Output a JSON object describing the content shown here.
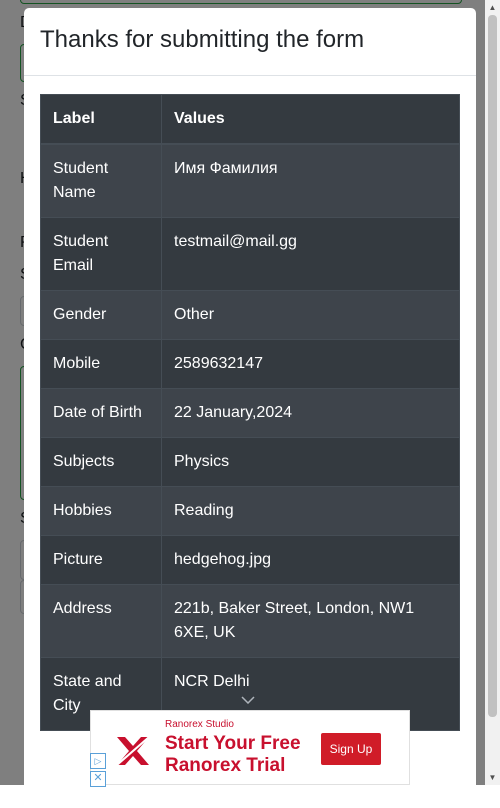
{
  "modal": {
    "title": "Thanks for submitting the form"
  },
  "table": {
    "headers": {
      "label": "Label",
      "values": "Values"
    },
    "rows": [
      {
        "label": "Student Name",
        "value": "Имя Фамилия"
      },
      {
        "label": "Student Email",
        "value": "testmail@mail.gg"
      },
      {
        "label": "Gender",
        "value": "Other"
      },
      {
        "label": "Mobile",
        "value": "2589632147"
      },
      {
        "label": "Date of Birth",
        "value": "22 January,2024"
      },
      {
        "label": "Subjects",
        "value": "Physics"
      },
      {
        "label": "Hobbies",
        "value": "Reading"
      },
      {
        "label": "Picture",
        "value": "hedgehog.jpg"
      },
      {
        "label": "Address",
        "value": "221b, Baker Street, London, NW1 6XE, UK"
      },
      {
        "label": "State and City",
        "value": "NCR Delhi"
      }
    ]
  },
  "background_page": {
    "label_initials": [
      "D",
      "S",
      "H",
      "P",
      "S",
      "C",
      "S"
    ]
  },
  "ad": {
    "sponsor": "Ranorex Studio",
    "headline": "Start Your Free Ranorex Trial",
    "cta": "Sign Up",
    "brand_color": "#c8102e"
  },
  "colors": {
    "table_dark": "#343a40",
    "table_stripe": "#3e444b",
    "success_border": "#28a745",
    "primary": "#007bff"
  },
  "icons": {
    "ad_choices": "play-triangle-icon",
    "ad_close": "close-icon",
    "dropdown": "chevron-down-icon"
  }
}
